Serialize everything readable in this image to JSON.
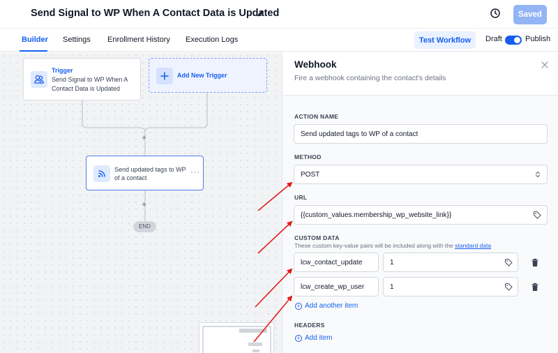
{
  "header": {
    "title": "Send Signal to WP When A Contact Data is Updated",
    "saved_label": "Saved"
  },
  "tabs": [
    {
      "label": "Builder",
      "active": true
    },
    {
      "label": "Settings",
      "active": false
    },
    {
      "label": "Enrollment History",
      "active": false
    },
    {
      "label": "Execution Logs",
      "active": false
    }
  ],
  "toolbar": {
    "test_workflow_label": "Test Workflow",
    "draft_label": "Draft",
    "publish_label": "Publish",
    "publish_toggle_on": true
  },
  "canvas": {
    "trigger": {
      "title": "Trigger",
      "description": "Send Signal to WP When A Contact Data is Updated"
    },
    "add_trigger_label": "Add New Trigger",
    "action": {
      "description": "Send updated tags to WP of a contact"
    },
    "add_symbol": "+",
    "end_label": "END"
  },
  "panel": {
    "title": "Webhook",
    "subtitle": "Fire a webhook containing the contact's details",
    "action_name": {
      "label": "ACTION NAME",
      "value": "Send updated tags to WP of a contact"
    },
    "method": {
      "label": "METHOD",
      "value": "POST"
    },
    "url": {
      "label": "URL",
      "value": "{{custom_values.membership_wp_website_link}}"
    },
    "custom_data": {
      "label": "CUSTOM DATA",
      "help_text": "These custom key-value pairs will be included along with the",
      "help_link": "standard data",
      "rows": [
        {
          "key": "lcw_contact_update",
          "value": "1"
        },
        {
          "key": "lcw_create_wp_user",
          "value": "1"
        }
      ],
      "add_label": "Add another item"
    },
    "headers": {
      "label": "HEADERS",
      "add_label": "Add item"
    }
  },
  "colors": {
    "accent": "#155eef",
    "annotation_arrow": "#e11d1d"
  }
}
